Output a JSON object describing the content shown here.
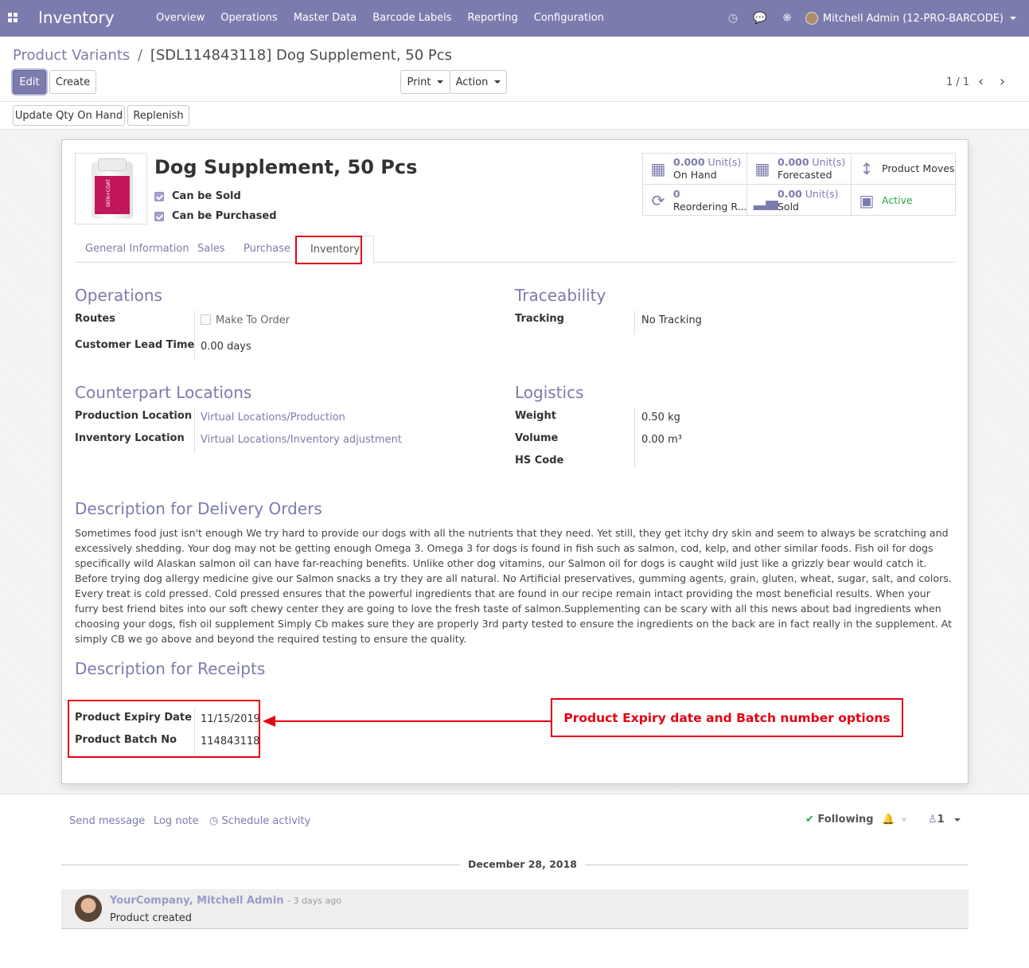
{
  "navbar": {
    "app_name": "Inventory",
    "menu": [
      "Overview",
      "Operations",
      "Master Data",
      "Barcode Labels",
      "Reporting",
      "Configuration"
    ],
    "user": "Mitchell Admin (12-PRO-BARCODE)",
    "bg_color": "#7c7bad"
  },
  "breadcrumb": {
    "parent": "Product Variants",
    "separator": "/",
    "current": "[SDL114843118] Dog Supplement, 50 Pcs"
  },
  "buttons": {
    "edit": "Edit",
    "create": "Create",
    "print": "Print",
    "action": "Action",
    "update_qty": "Update Qty On Hand",
    "replenish": "Replenish"
  },
  "pager": {
    "text": "1 / 1"
  },
  "product": {
    "name": "Dog Supplement, 50 Pcs",
    "can_be_sold": "Can be Sold",
    "can_be_purchased": "Can be Purchased",
    "image_label": "SKIN+COAT"
  },
  "smart_buttons": {
    "on_hand_value": "0.000",
    "on_hand_unit": "Unit(s)",
    "on_hand_label": "On Hand",
    "forecast_value": "0.000",
    "forecast_unit": "Unit(s)",
    "forecast_label": "Forecasted",
    "moves_label": "Product Moves",
    "reorder_value": "0",
    "reorder_label": "Reordering R...",
    "sold_value": "0.00",
    "sold_unit": "Unit(s)",
    "sold_label": "Sold",
    "active_label": "Active"
  },
  "tabs": [
    "General Information",
    "Sales",
    "Purchase",
    "Inventory"
  ],
  "operations": {
    "title": "Operations",
    "routes_label": "Routes",
    "routes_value": "Make To Order",
    "lead_time_label": "Customer Lead Time",
    "lead_time_value": "0.00 days"
  },
  "traceability": {
    "title": "Traceability",
    "tracking_label": "Tracking",
    "tracking_value": "No Tracking"
  },
  "counterpart": {
    "title": "Counterpart Locations",
    "production_label": "Production Location",
    "production_value": "Virtual Locations/Production",
    "inventory_label": "Inventory Location",
    "inventory_value": "Virtual Locations/Inventory adjustment"
  },
  "logistics": {
    "title": "Logistics",
    "weight_label": "Weight",
    "weight_value": "0.50",
    "weight_unit": "kg",
    "volume_label": "Volume",
    "volume_value": "0.00",
    "volume_unit": "m³",
    "hs_label": "HS Code"
  },
  "delivery_desc": {
    "title": "Description for Delivery Orders",
    "text": "Sometimes food just isn't enough We try hard to provide our dogs with all the nutrients that they need. Yet still, they get itchy dry skin and seem to always be scratching and excessively shedding. Your dog may not be getting enough Omega 3. Omega 3 for dogs is found in fish such as salmon, cod, kelp, and other similar foods. Fish oil for dogs specifically wild Alaskan salmon oil can have far-reaching benefits. Unlike other dog vitamins, our Salmon oil for dogs is caught wild just like a grizzly bear would catch it. Before trying dog allergy medicine give our Salmon snacks a try they are all natural. No Artificial preservatives, gumming agents, grain, gluten, wheat, sugar, salt, and colors. Every treat is cold pressed. Cold pressed ensures that the powerful ingredients that are found in our recipe remain intact providing the most beneficial results. When your furry best friend bites into our soft chewy center they are going to love the fresh taste of salmon.Supplementing can be scary with all this news about bad ingredients when choosing your dogs, fish oil supplement Simply Cb makes sure they are properly 3rd party tested to ensure the ingredients on the back are in fact really in the supplement. At simply CB we go above and beyond the required testing to ensure the quality."
  },
  "receipts_desc": {
    "title": "Description for Receipts",
    "expiry_label": "Product Expiry Date",
    "expiry_value": "11/15/2019",
    "batch_label": "Product Batch No",
    "batch_value": "114843118"
  },
  "annotation": {
    "text": "Product Expiry date and Batch number options",
    "color": "#e60012"
  },
  "chatter": {
    "send_message": "Send message",
    "log_note": "Log note",
    "schedule_activity": "Schedule activity",
    "following": "Following",
    "followers_count": "1",
    "date": "December 28, 2018",
    "message_author": "YourCompany, Mitchell Admin",
    "message_time": "- 3 days ago",
    "message_body": "Product created"
  }
}
